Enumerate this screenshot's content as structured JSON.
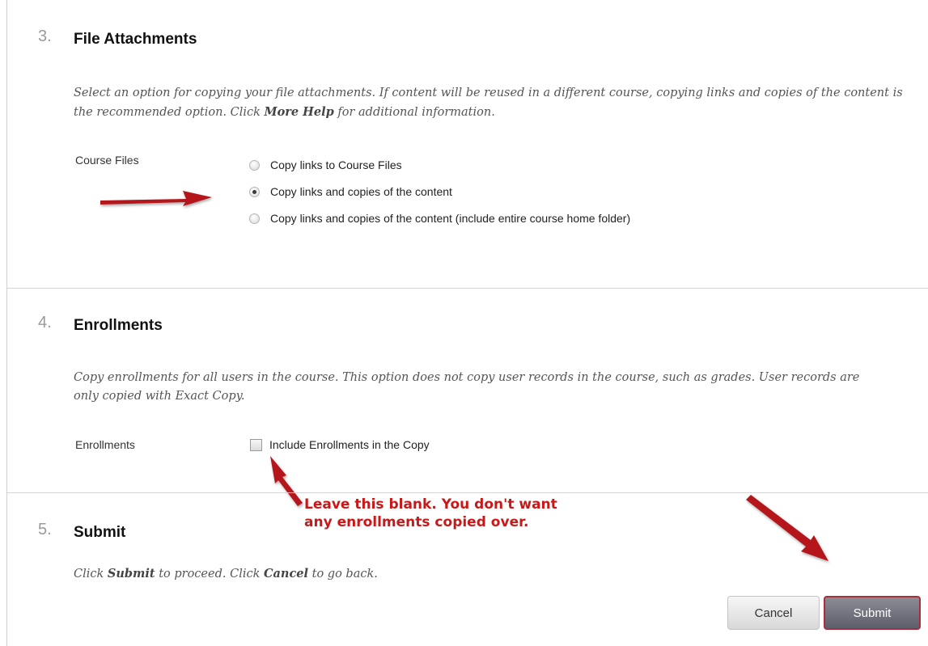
{
  "sections": {
    "file_attachments": {
      "number": "3.",
      "title": "File Attachments",
      "instructions_part1": "Select an option for copying your file attachments. If content will be reused in a different course, copying links and copies of the content is the recommended option. Click ",
      "instructions_bold": "More Help",
      "instructions_part2": " for additional information.",
      "field_label": "Course Files",
      "options": [
        {
          "label": "Copy links to Course Files",
          "selected": false
        },
        {
          "label": "Copy links and copies of the content",
          "selected": true
        },
        {
          "label": "Copy links and copies of the content (include entire course home folder)",
          "selected": false
        }
      ]
    },
    "enrollments": {
      "number": "4.",
      "title": "Enrollments",
      "instructions": "Copy enrollments for all users in the course. This option does not copy user records in the course, such as grades. User records are only copied with Exact Copy.",
      "field_label": "Enrollments",
      "checkbox_label": "Include Enrollments in the Copy",
      "checked": false
    },
    "submit": {
      "number": "5.",
      "title": "Submit",
      "instructions_part1": "Click ",
      "instructions_bold1": "Submit",
      "instructions_part2": " to proceed. Click ",
      "instructions_bold2": "Cancel",
      "instructions_part3": " to go back."
    }
  },
  "annotation": {
    "line1": "Leave this blank. You don't want",
    "line2": "any enrollments copied over.",
    "color": "#c8191a"
  },
  "buttons": {
    "cancel_label": "Cancel",
    "submit_label": "Submit"
  },
  "colors": {
    "arrow": "#b5161b",
    "submit_border": "#a73040"
  }
}
